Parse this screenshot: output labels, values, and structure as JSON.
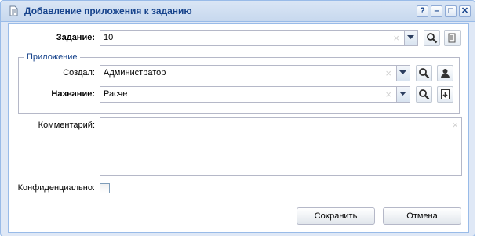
{
  "window": {
    "title": "Добавление приложения к заданию",
    "tools": {
      "help": "?",
      "minimize": "–",
      "maximize": "□",
      "close": "✕"
    }
  },
  "form": {
    "task_label": "Задание:",
    "task_value": "10",
    "attachment_group": "Приложение",
    "author_label": "Создал:",
    "author_value": "Администратор",
    "name_label": "Название:",
    "name_value": "Расчет",
    "comment_label": "Комментарий:",
    "comment_value": "",
    "confidential_label": "Конфиденциально:",
    "confidential_checked": false,
    "clear_glyph": "×"
  },
  "buttons": {
    "save": "Сохранить",
    "cancel": "Отмена"
  },
  "icons": [
    "document-icon",
    "search-icon",
    "notes-icon",
    "user-icon",
    "download-icon",
    "dropdown-arrow-icon"
  ],
  "colors": {
    "title_text": "#15428b",
    "border": "#99bbe8",
    "window_bg": "#dfe8f6"
  }
}
